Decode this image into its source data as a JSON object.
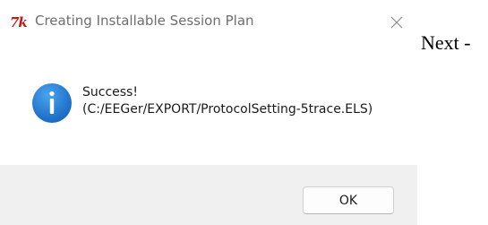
{
  "dialog": {
    "title": "Creating Installable Session Plan",
    "app_icon": "tk-feather-icon",
    "close_icon": "close-icon",
    "info_icon": "info-icon",
    "message_line_1": "Success!",
    "message_line_2": "(C:/EEGer/EXPORT/ProtocolSetting-5trace.ELS)",
    "ok_label": "OK"
  },
  "background": {
    "text": "Next -"
  },
  "colors": {
    "info_blue": "#1f7fd6",
    "tk_icon_red": "#c41818"
  }
}
